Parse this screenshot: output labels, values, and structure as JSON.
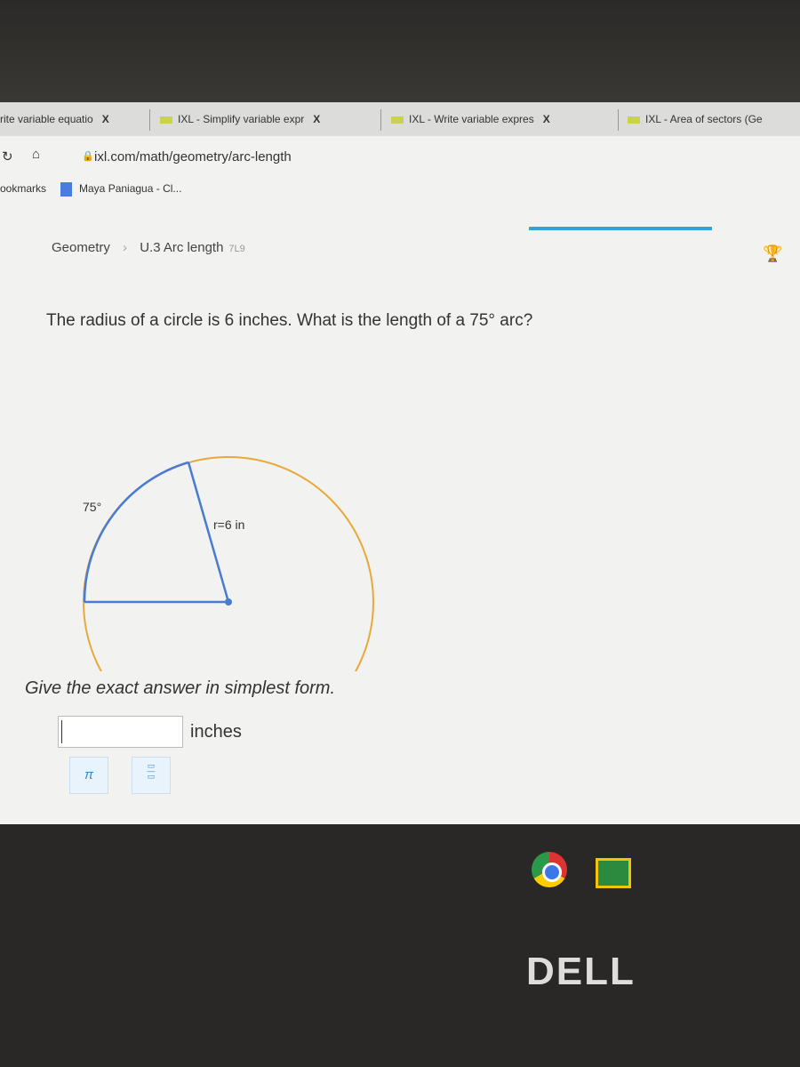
{
  "browser": {
    "tabs": [
      {
        "label": "rite variable equatio",
        "close": "X"
      },
      {
        "label": "IXL - Simplify variable expr",
        "close": "X"
      },
      {
        "label": "IXL - Write variable expres",
        "close": "X"
      },
      {
        "label": "IXL - Area of sectors (Ge",
        "close": ""
      }
    ],
    "url": "ixl.com/math/geometry/arc-length",
    "bookmarks_label": "ookmarks",
    "bookmark_item": "Maya Paniagua - Cl..."
  },
  "breadcrumb": {
    "subject": "Geometry",
    "skill": "U.3 Arc length",
    "code": "7L9"
  },
  "question": "The radius of a circle is 6 inches. What is the length of a 75° arc?",
  "figure": {
    "angle_label": "75°",
    "radius_label": "r=6 in",
    "arc_color": "#e8a93a",
    "sector_color": "#4a7bd0"
  },
  "instruction": "Give the exact answer in simplest form.",
  "answer": {
    "value": "",
    "unit": "inches"
  },
  "keypad": {
    "pi": "π",
    "fraction": "fraction"
  },
  "progress_color": "#3aa0d8",
  "brand": "DELL"
}
